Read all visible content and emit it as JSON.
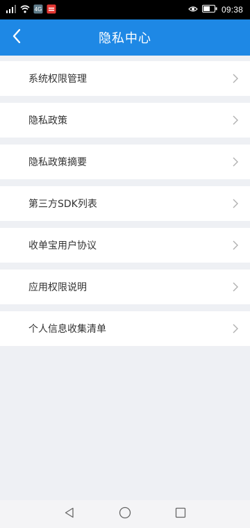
{
  "status_bar": {
    "time": "09:38",
    "carrier_badge": "4G",
    "icons": [
      "signal-icon",
      "wifi-icon",
      "nfc-icon",
      "app-notification-icon",
      "eye-comfort-icon",
      "battery-icon"
    ]
  },
  "app_bar": {
    "title": "隐私中心",
    "back_icon": "back-arrow-icon",
    "color": "#1e88e5"
  },
  "menu": {
    "items": [
      {
        "label": "系统权限管理"
      },
      {
        "label": "隐私政策"
      },
      {
        "label": "隐私政策摘要"
      },
      {
        "label": "第三方SDK列表"
      },
      {
        "label": "收单宝用户协议"
      },
      {
        "label": "应用权限说明"
      },
      {
        "label": "个人信息收集清单"
      }
    ],
    "chevron_icon": "chevron-right-icon"
  },
  "nav_bar": {
    "buttons": [
      "back-triangle-icon",
      "home-circle-icon",
      "recents-square-icon"
    ]
  }
}
